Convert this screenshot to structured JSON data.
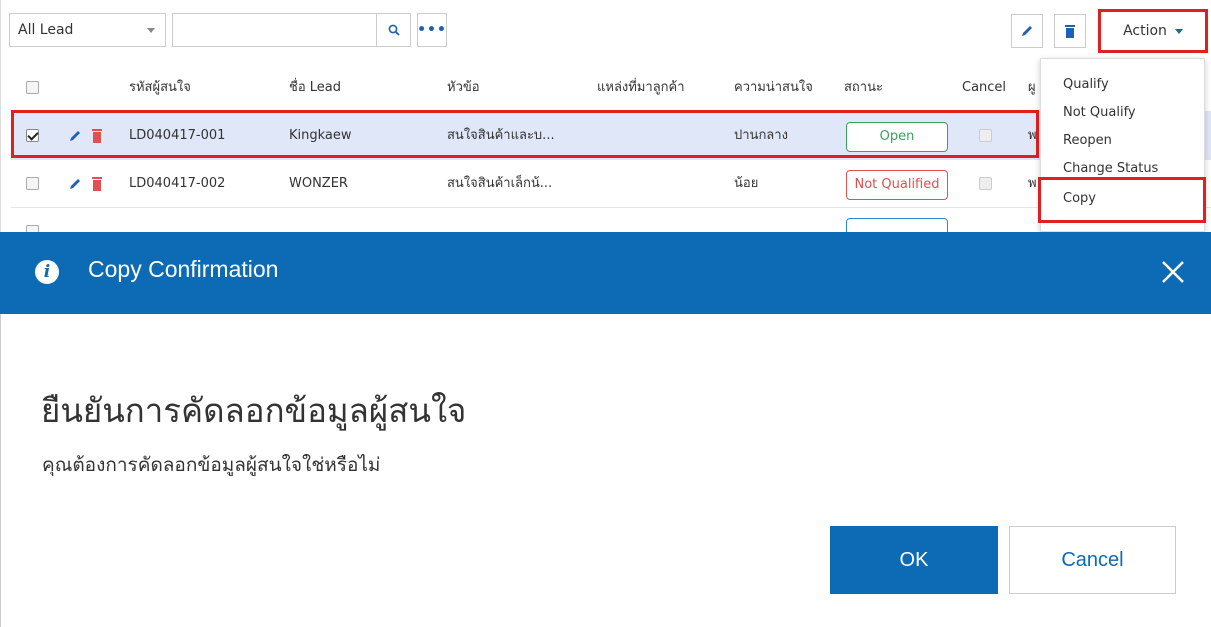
{
  "toolbar": {
    "filter_value": "All Lead",
    "search_placeholder": "",
    "more_label": "•••",
    "action_label": "Action"
  },
  "grid": {
    "headers": [
      "รหัสผู้สนใจ",
      "ชื่อ Lead",
      "หัวข้อ",
      "แหล่งที่มาลูกค้า",
      "ความน่าสนใจ",
      "สถานะ",
      "Cancel",
      "ผู"
    ],
    "rows": [
      {
        "code": "LD040417-001",
        "name": "Kingkaew",
        "topic": "สนใจสินค้าและบ...",
        "source": "",
        "interest": "ปานกลาง",
        "status": "Open",
        "owner_partial": "พ",
        "selected": true
      },
      {
        "code": "LD040417-002",
        "name": "WONZER",
        "topic": "สนใจสินค้าเล็กน้...",
        "source": "",
        "interest": "น้อย",
        "status": "Not Qualified",
        "owner_partial": "พ",
        "selected": false
      }
    ]
  },
  "action_menu": {
    "items": [
      "Qualify",
      "Not Qualify",
      "Reopen",
      "Change Status",
      "Copy"
    ]
  },
  "dialog": {
    "title": "Copy Confirmation",
    "heading": "ยืนยันการคัดลอกข้อมูลผู้สนใจ",
    "message": "คุณต้องการคัดลอกข้อมูลผู้สนใจใช่หรือไม่",
    "ok_label": "OK",
    "cancel_label": "Cancel"
  },
  "colors": {
    "primary": "#0d6ab5",
    "highlight": "#e02020",
    "selected_row": "#dfe7f8",
    "status_open": "#3aa35a",
    "status_not_qualified": "#e05050"
  },
  "icons": [
    "chevron-down-icon",
    "search-icon",
    "ellipsis-icon",
    "pencil-icon",
    "trash-icon",
    "info-icon",
    "close-icon"
  ]
}
